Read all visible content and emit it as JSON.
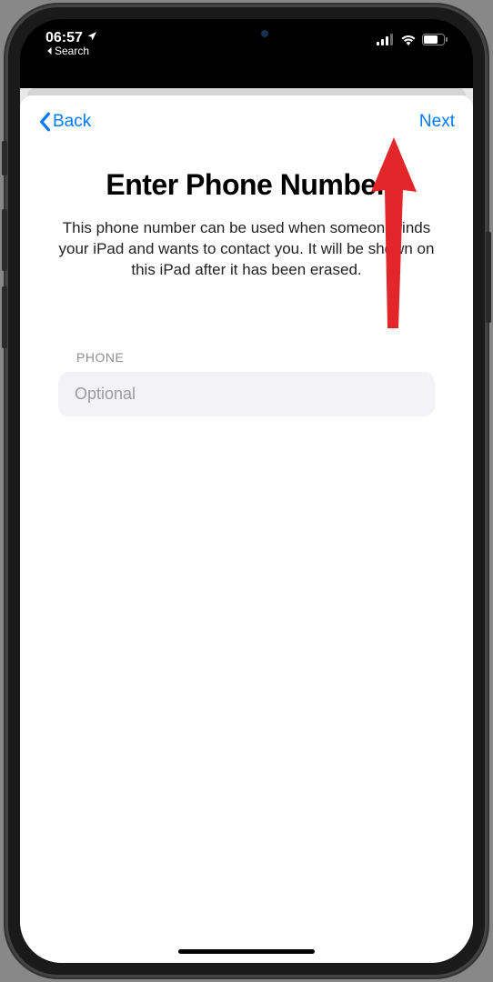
{
  "status_bar": {
    "time": "06:57",
    "breadcrumb": "Search"
  },
  "nav": {
    "back_label": "Back",
    "next_label": "Next"
  },
  "main": {
    "title": "Enter Phone Number",
    "description": "This phone number can be used when someone finds your iPad and wants to contact you. It will be shown on this iPad after it has been erased."
  },
  "form": {
    "phone_label": "PHONE",
    "phone_placeholder": "Optional",
    "phone_value": ""
  }
}
